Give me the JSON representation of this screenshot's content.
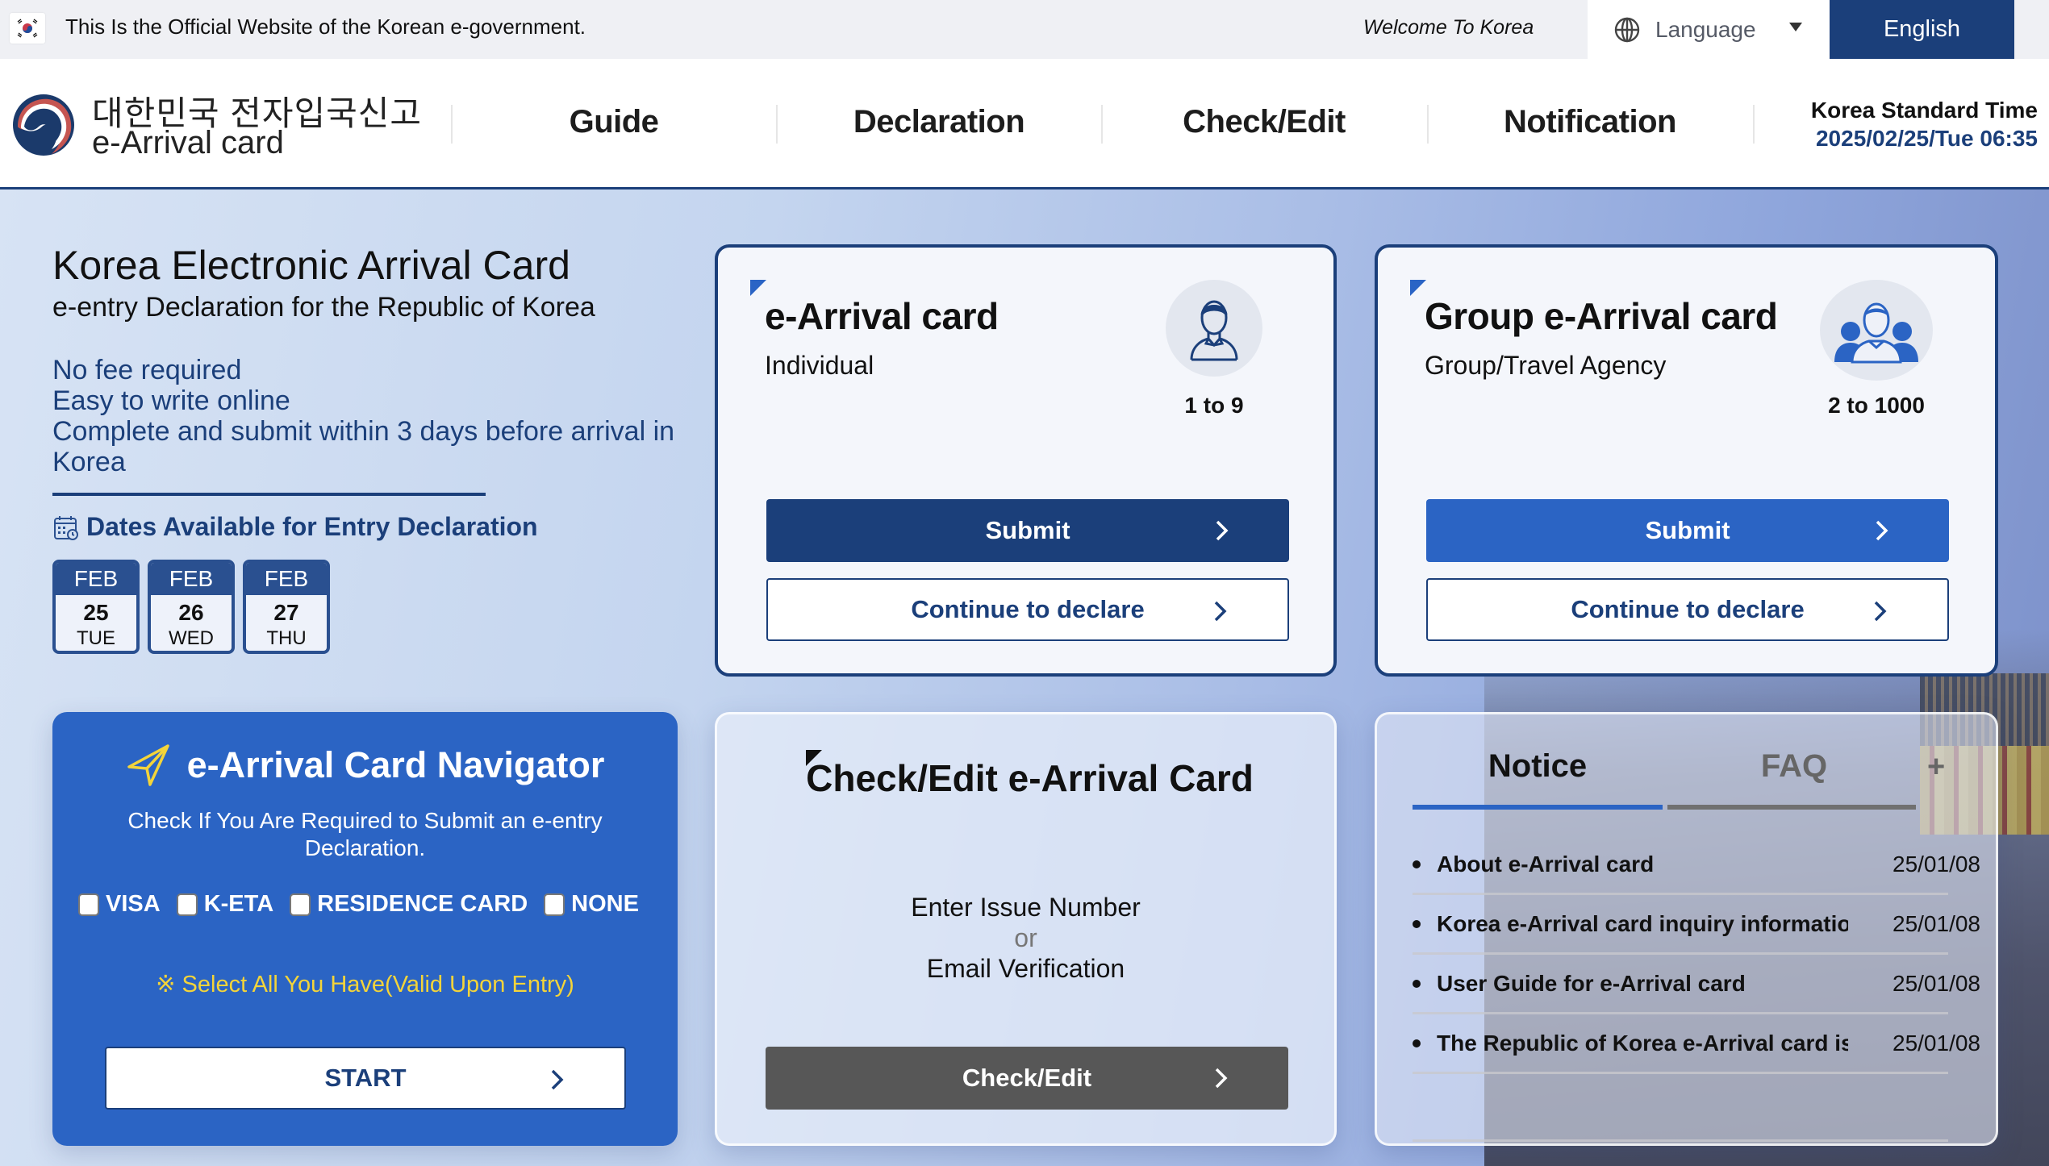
{
  "topbar": {
    "official_text": "This Is the Official Website of the Korean e-government.",
    "welcome_text": "Welcome To Korea",
    "language_label": "Language",
    "current_language": "English",
    "flag_icon": "korea-flag-icon",
    "globe_icon": "globe-icon"
  },
  "header": {
    "logo_korean": "대한민국 전자입국신고",
    "logo_english": "e-Arrival card",
    "nav": [
      "Guide",
      "Declaration",
      "Check/Edit",
      "Notification"
    ],
    "time_label": "Korea Standard Time",
    "time_value": "2025/02/25/Tue 06:35"
  },
  "intro": {
    "title": "Korea Electronic Arrival Card",
    "subtitle": "e-entry Declaration for the Republic of Korea",
    "points": [
      "No fee required",
      "Easy to write online",
      "Complete and submit within 3 days before arrival in Korea"
    ],
    "dates_title": "Dates Available for Entry Declaration",
    "dates": [
      {
        "month": "FEB",
        "day": "25",
        "weekday": "TUE"
      },
      {
        "month": "FEB",
        "day": "26",
        "weekday": "WED"
      },
      {
        "month": "FEB",
        "day": "27",
        "weekday": "THU"
      }
    ]
  },
  "individual_card": {
    "title": "e-Arrival card",
    "subtitle": "Individual",
    "range": "1 to 9",
    "submit_label": "Submit",
    "continue_label": "Continue to declare"
  },
  "group_card": {
    "title": "Group e-Arrival card",
    "subtitle": "Group/Travel Agency",
    "range": "2 to 1000",
    "submit_label": "Submit",
    "continue_label": "Continue to declare"
  },
  "navigator": {
    "title": "e-Arrival Card Navigator",
    "description": "Check If You Are Required to Submit an e-entry Declaration.",
    "options": [
      {
        "label": "VISA",
        "checked": false
      },
      {
        "label": "K-ETA",
        "checked": false
      },
      {
        "label": "RESIDENCE CARD",
        "checked": false
      },
      {
        "label": "NONE",
        "checked": false
      }
    ],
    "note": "※ Select All You Have(Valid Upon Entry)",
    "start_label": "START"
  },
  "check_card": {
    "title": "Check/Edit e-Arrival Card",
    "line1": "Enter Issue Number",
    "or": "or",
    "line2": "Email Verification",
    "button_label": "Check/Edit"
  },
  "notice_card": {
    "tabs": [
      "Notice",
      "FAQ"
    ],
    "active_tab": "Notice",
    "more_label": "+",
    "items": [
      {
        "title": "About e-Arrival card",
        "date": "25/01/08"
      },
      {
        "title": "Korea e-Arrival card inquiry information",
        "date": "25/01/08"
      },
      {
        "title": "User Guide for e-Arrival card",
        "date": "25/01/08"
      },
      {
        "title": "The Republic of Korea e-Arrival card is free",
        "date": "25/01/08"
      }
    ]
  },
  "colors": {
    "navy": "#1b3f7a",
    "blue": "#2b64c4",
    "yellow": "#f3d43a",
    "gray_button": "#575757"
  }
}
